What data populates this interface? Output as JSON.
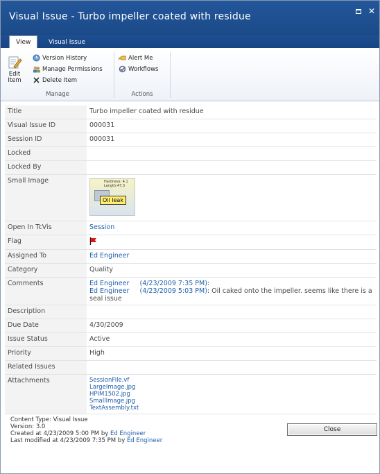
{
  "window": {
    "title": "Visual Issue - Turbo impeller coated with residue",
    "restore_glyph": "",
    "close_glyph": "✕"
  },
  "tabs": [
    {
      "label": "View",
      "active": true
    },
    {
      "label": "Visual Issue",
      "active": false
    }
  ],
  "ribbon": {
    "manage": {
      "label": "Manage",
      "edit_item": "Edit Item",
      "version_history": "Version History",
      "manage_permissions": "Manage Permissions",
      "delete_item": "Delete Item"
    },
    "actions": {
      "label": "Actions",
      "alert_me": "Alert Me",
      "workflows": "Workflows"
    }
  },
  "fields": {
    "title": {
      "label": "Title",
      "value": "Turbo impeller coated with residue"
    },
    "visual_issue_id": {
      "label": "Visual Issue ID",
      "value": "000031"
    },
    "session_id": {
      "label": "Session ID",
      "value": "000031"
    },
    "locked": {
      "label": "Locked",
      "value": ""
    },
    "locked_by": {
      "label": "Locked By",
      "value": ""
    },
    "small_image": {
      "label": "Small Image",
      "thumb_line1": "Hardness: 4.1",
      "thumb_line2": "Length:47.3",
      "thumb_tag": "Oil leak"
    },
    "open_in_tcvis": {
      "label": "Open In TcVis",
      "value": "Session"
    },
    "flag": {
      "label": "Flag",
      "color": "#d21a1a"
    },
    "assigned_to": {
      "label": "Assigned To",
      "value": "Ed Engineer"
    },
    "category": {
      "label": "Category",
      "value": "Quality"
    },
    "comments": {
      "label": "Comments",
      "entries": [
        {
          "author": "Ed Engineer",
          "time": "(4/23/2009 7:35 PM)",
          "text": ":"
        },
        {
          "author": "Ed Engineer",
          "time": "(4/23/2009 5:03 PM)",
          "text": ": Oil caked onto the impeller.  seems like there is a seal issue"
        }
      ]
    },
    "description": {
      "label": "Description",
      "value": ""
    },
    "due_date": {
      "label": "Due Date",
      "value": "4/30/2009"
    },
    "issue_status": {
      "label": "Issue Status",
      "value": "Active"
    },
    "priority": {
      "label": "Priority",
      "value": "High"
    },
    "related_issues": {
      "label": "Related Issues",
      "value": ""
    },
    "attachments": {
      "label": "Attachments",
      "files": [
        "SessionFile.vf",
        "LargeImage.jpg",
        "HPIM1502.jpg",
        "SmallImage.jpg",
        "TextAssembly.txt"
      ]
    }
  },
  "footer": {
    "content_type": "Content Type: Visual Issue",
    "version": "Version: 3.0",
    "created_prefix": "Created at 4/23/2009 5:00 PM by ",
    "created_by": "Ed Engineer",
    "modified_prefix": "Last modified at 4/23/2009 7:35 PM by ",
    "modified_by": "Ed Engineer",
    "close_label": "Close"
  }
}
